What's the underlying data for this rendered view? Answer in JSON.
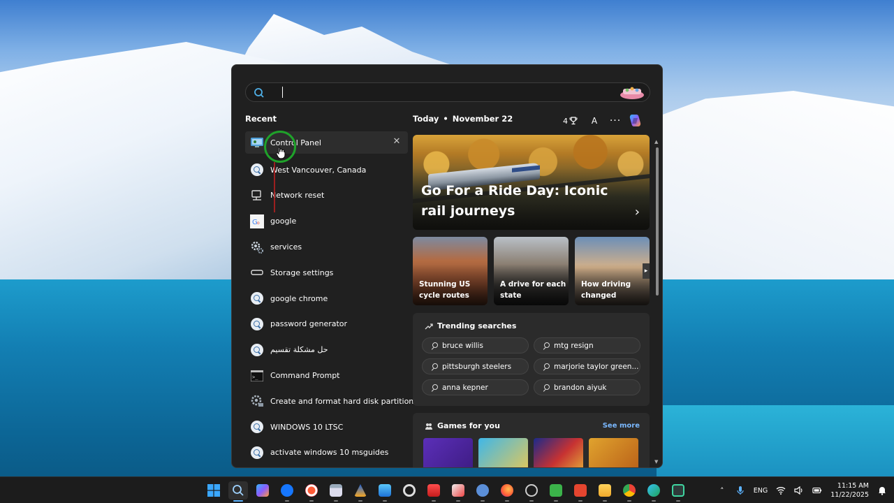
{
  "search": {
    "value": "",
    "placeholder": ""
  },
  "recent": {
    "title": "Recent",
    "items": [
      {
        "label": "Control Panel",
        "icon": "control-panel-icon"
      },
      {
        "label": "West Vancouver, Canada",
        "icon": "search-icon"
      },
      {
        "label": "Network reset",
        "icon": "network-icon"
      },
      {
        "label": "google",
        "icon": "google-icon"
      },
      {
        "label": "services",
        "icon": "services-gear-icon"
      },
      {
        "label": "Storage settings",
        "icon": "storage-icon"
      },
      {
        "label": "google chrome",
        "icon": "search-icon"
      },
      {
        "label": "password generator",
        "icon": "search-icon"
      },
      {
        "label": "حل مشكلة تقسيم",
        "icon": "search-icon"
      },
      {
        "label": "Command Prompt",
        "icon": "terminal-icon"
      },
      {
        "label": "Create and format hard disk partitions",
        "icon": "disk-management-icon"
      },
      {
        "label": "WINDOWS 10 LTSC",
        "icon": "search-icon"
      },
      {
        "label": "activate windows 10 msguides",
        "icon": "search-icon"
      }
    ],
    "close_symbol": "✕"
  },
  "header": {
    "today": "Today",
    "date": "November 22",
    "points": "4",
    "account_letter": "A",
    "more": "···"
  },
  "hero": {
    "title": "Go For a Ride Day: Iconic rail journeys",
    "arrow": "›"
  },
  "cards": [
    {
      "title": "Stunning US cycle routes"
    },
    {
      "title": "A drive for each state"
    },
    {
      "title": "How driving changed"
    }
  ],
  "trending": {
    "title": "Trending searches",
    "items": [
      "bruce willis",
      "mtg resign",
      "pittsburgh steelers",
      "marjorie taylor green...",
      "anna kepner",
      "brandon aiyuk"
    ]
  },
  "games": {
    "title": "Games for you",
    "see_more": "See more"
  },
  "taskbar": {
    "language": "ENG",
    "time": "11:15 AM",
    "date": "11/22/2025"
  },
  "colors": {
    "accent": "#5cb3ff",
    "panel": "#202020",
    "highlight": "#2d2d2d",
    "annotation_green": "#1fa22a",
    "annotation_red": "#b32020"
  }
}
